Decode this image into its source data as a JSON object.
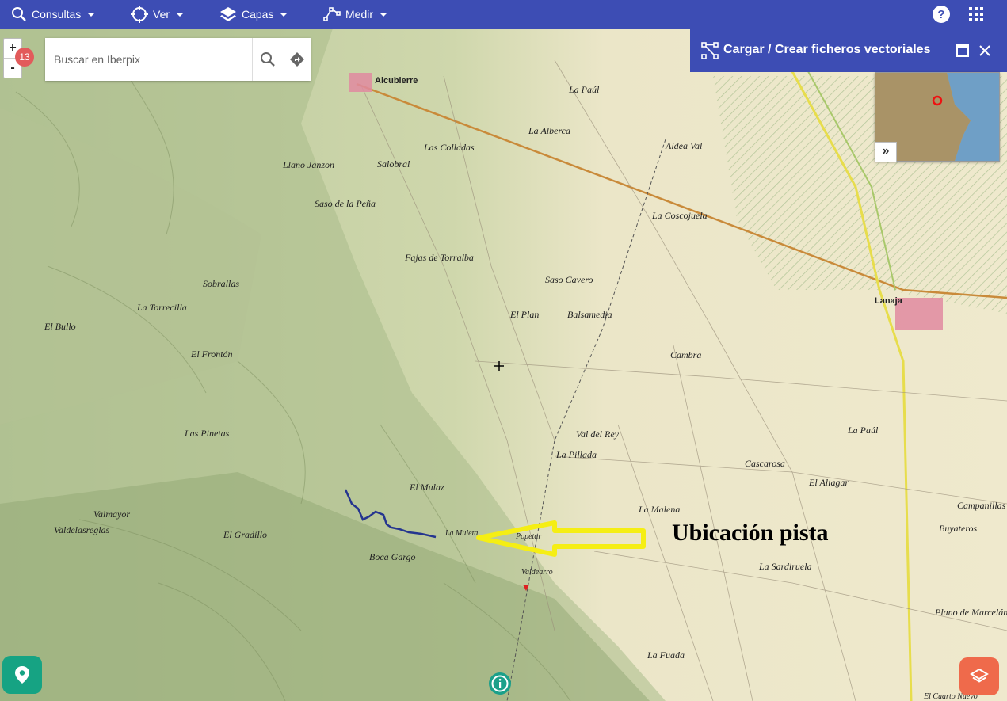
{
  "toolbar": {
    "menus": [
      {
        "label": "Consultas",
        "icon": "search-icon"
      },
      {
        "label": "Ver",
        "icon": "crosshair-icon"
      },
      {
        "label": "Capas",
        "icon": "layers-icon"
      },
      {
        "label": "Medir",
        "icon": "measure-icon"
      }
    ],
    "right_icons": [
      "help-icon",
      "apps-grid-icon"
    ]
  },
  "zoom": {
    "in": "+",
    "out": "-",
    "level": "13"
  },
  "search": {
    "placeholder": "Buscar en Iberpix"
  },
  "panel": {
    "title": "Cargar / Crear ficheros vectoriales",
    "icons": [
      "vector-file-icon",
      "maximize-icon",
      "close-icon"
    ]
  },
  "overview": {
    "toggle": "»"
  },
  "annotation": {
    "text": "Ubicación pista",
    "arrow_color": "#f5ee14"
  },
  "route_color": "#25358f",
  "map_labels": {
    "alcubierre": "Alcubierre",
    "lanaja": "Lanaja",
    "la_albera": "La Alberca",
    "las_collados": "Las Colladas",
    "salobral": "Salobral",
    "llano_janzon": "Llano Janzon",
    "saso_pena": "Saso de la Peña",
    "fajas": "Fajas de Torralba",
    "el_plan": "El Plan",
    "balsamedia": "Balsamedia",
    "cambra": "Cambra",
    "val_rey": "Val del Rey",
    "la_pillada": "La Pillada",
    "la_malena": "La Malena",
    "popetar": "Popetar",
    "valdelarco": "Valdearro",
    "la_sardiruela": "La Sardiruela",
    "el_aliagar": "El Aliagar",
    "campanillas": "Campanillas",
    "buyateros": "Buyateros",
    "plano_marcelan": "Plano de Marcelán",
    "la_paul": "La Paúl",
    "cascarosa": "Cascarosa",
    "la_coscojuela": "La Coscojuela",
    "aldea_val": "Aldea Val",
    "la_paul_north": "La Paúl",
    "sobrallas": "Sobrallas",
    "la_torrecilla": "La Torrecilla",
    "el_bullo": "El Bullo",
    "el_fronton": "El Frontón",
    "las_pinetas": "Las Pinetas",
    "valdelosvallas": "Valdelasreglas",
    "valmayor": "Valmayor",
    "el_gradillo": "El Gradillo",
    "boca_gargo": "Boca Gargo",
    "la_muleta": "La Muleta",
    "el_mulaz": "El Mulaz",
    "saso_cavero": "Saso Cavero",
    "la_fuada": "La Fuada",
    "el_cuarto_nuevo": "El Cuarto Nuevo"
  }
}
